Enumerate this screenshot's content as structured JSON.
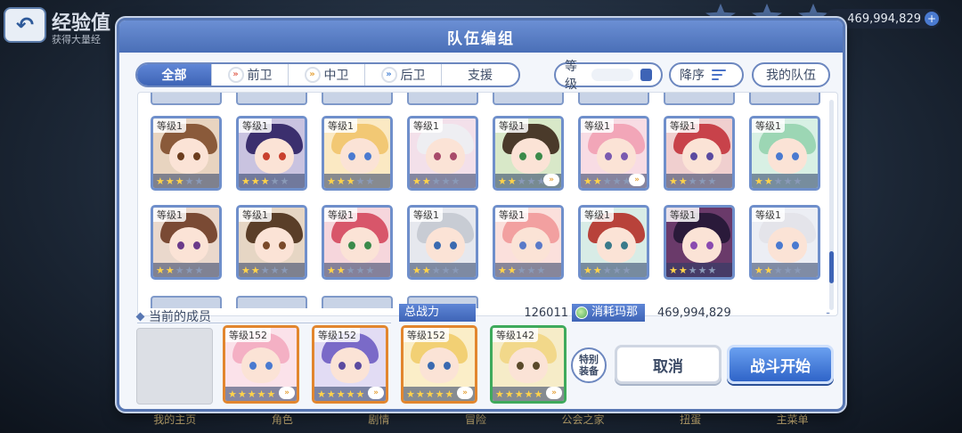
{
  "background": {
    "screen_title": "经验值",
    "screen_subtitle": "获得大量经",
    "money": "469,994,829",
    "bottom_nav": [
      "我的主页",
      "角色",
      "剧情",
      "冒险",
      "公会之家",
      "扭蛋",
      "主菜单"
    ]
  },
  "dialog": {
    "title": "队伍编组"
  },
  "filters": {
    "tabs": [
      {
        "label": "全部",
        "icon": "",
        "active": true
      },
      {
        "label": "前卫",
        "icon": "front-position-icon",
        "active": false
      },
      {
        "label": "中卫",
        "icon": "middle-position-icon",
        "active": false
      },
      {
        "label": "后卫",
        "icon": "rear-position-icon",
        "active": false
      },
      {
        "label": "支援",
        "icon": "",
        "active": false
      }
    ],
    "sort_field": "等级",
    "sort_order": "降序",
    "my_team": "我的队伍"
  },
  "roster": [
    {
      "level": "等级1",
      "stars": 3,
      "hair": "#8a5a3a",
      "eye": "#6b3d1e",
      "bg": "#e8d4c0",
      "badge": false
    },
    {
      "level": "等级1",
      "stars": 3,
      "hair": "#3b2f6e",
      "eye": "#c9402e",
      "bg": "#c9c3e0",
      "badge": false
    },
    {
      "level": "等级1",
      "stars": 3,
      "hair": "#f2c874",
      "eye": "#4a7ad0",
      "bg": "#fbe9c3",
      "badge": false
    },
    {
      "level": "等级1",
      "stars": 2,
      "hair": "#eeeef2",
      "eye": "#a84a6a",
      "bg": "#f3e0ea",
      "badge": false
    },
    {
      "level": "等级1",
      "stars": 2,
      "hair": "#4a3a2a",
      "eye": "#3a8a4a",
      "bg": "#d8e8c8",
      "badge": true
    },
    {
      "level": "等级1",
      "stars": 2,
      "hair": "#f2a6b8",
      "eye": "#7a5ab0",
      "bg": "#f8dce4",
      "badge": true
    },
    {
      "level": "等级1",
      "stars": 2,
      "hair": "#c8424a",
      "eye": "#5a4aa0",
      "bg": "#f0cfcf",
      "badge": false
    },
    {
      "level": "等级1",
      "stars": 2,
      "hair": "#9cd6b4",
      "eye": "#4a7ad0",
      "bg": "#d8f0e4",
      "badge": false
    },
    {
      "level": "等级1",
      "stars": 2,
      "hair": "#7a4a34",
      "eye": "#6a3a8a",
      "bg": "#ead8cc",
      "badge": false
    },
    {
      "level": "等级1",
      "stars": 2,
      "hair": "#5a3e28",
      "eye": "#7a4a2a",
      "bg": "#e6d6c4",
      "badge": false
    },
    {
      "level": "等级1",
      "stars": 2,
      "hair": "#d8566a",
      "eye": "#3a8a4a",
      "bg": "#f6d6dc",
      "badge": false
    },
    {
      "level": "等级1",
      "stars": 2,
      "hair": "#c8ccd4",
      "eye": "#3a6ab0",
      "bg": "#e6e8ee",
      "badge": false
    },
    {
      "level": "等级1",
      "stars": 2,
      "hair": "#f2a0a0",
      "eye": "#5a7ac8",
      "bg": "#fbe0dc",
      "badge": false
    },
    {
      "level": "等级1",
      "stars": 2,
      "hair": "#b8423a",
      "eye": "#3a7a8a",
      "bg": "#d8ece6",
      "badge": false
    },
    {
      "level": "等级1",
      "stars": 2,
      "hair": "#2a1a3a",
      "eye": "#8a4ab0",
      "bg": "#6a3a6a",
      "badge": false
    },
    {
      "level": "等级1",
      "stars": 2,
      "hair": "#e4e4ea",
      "eye": "#4a7ad0",
      "bg": "#eceef4",
      "badge": false
    }
  ],
  "current_members": {
    "label": "当前的成员",
    "total_power_label": "总战力",
    "total_power": "126011",
    "mana_label": "消耗玛那",
    "mana": "469,994,829",
    "mana_dash": "-",
    "team": [
      {
        "level": "等级152",
        "stars": 5,
        "hair": "#f4b0c4",
        "eye": "#4a7ad0",
        "bg": "#fbe2ea",
        "frame": "orange"
      },
      {
        "level": "等级152",
        "stars": 5,
        "hair": "#7a6ac8",
        "eye": "#5a4aa0",
        "bg": "#e2dcf4",
        "frame": "orange"
      },
      {
        "level": "等级152",
        "stars": 5,
        "hair": "#f2d074",
        "eye": "#3a6ab0",
        "bg": "#fbeec8",
        "frame": "orange"
      },
      {
        "level": "等级142",
        "stars": 5,
        "hair": "#f2d88a",
        "eye": "#5a4a2a",
        "bg": "#f6ecc8",
        "frame": "green"
      }
    ]
  },
  "buttons": {
    "special_equip": "特别装备",
    "cancel": "取消",
    "start": "战斗开始"
  }
}
